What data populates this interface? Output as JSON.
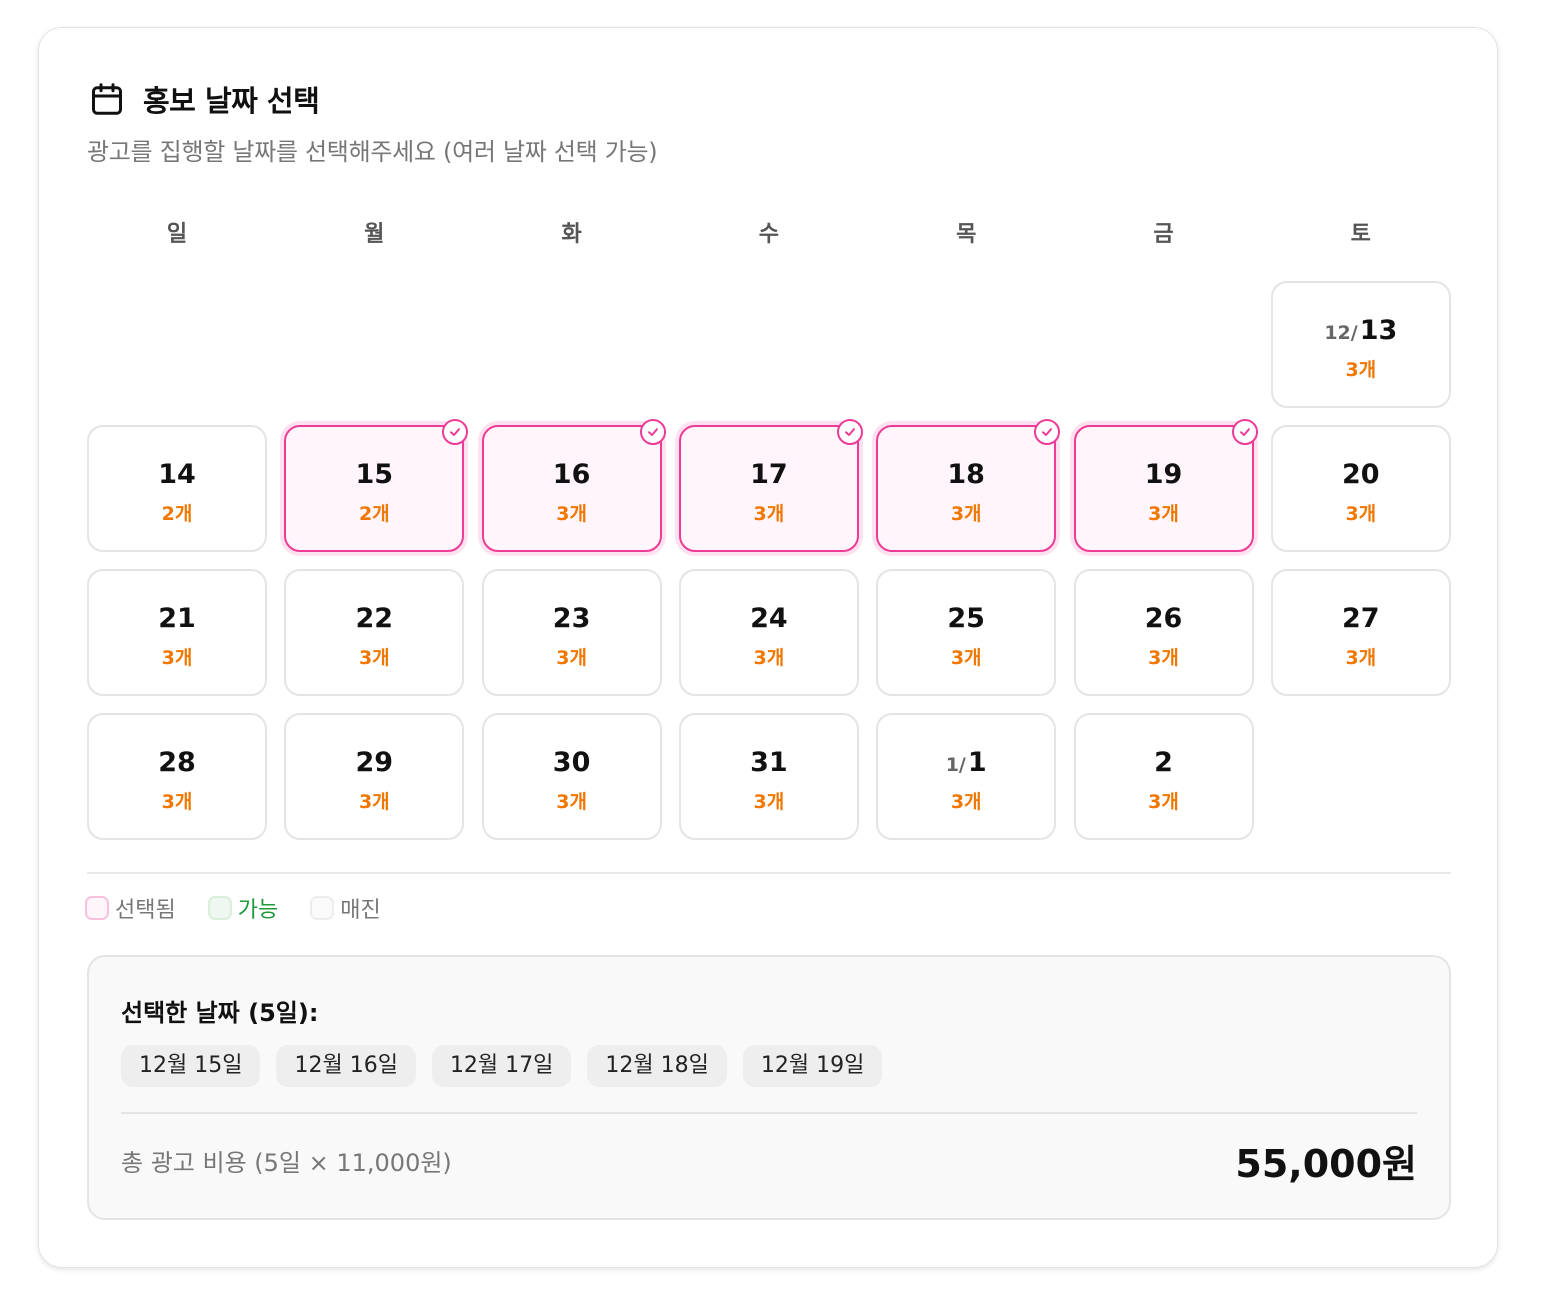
{
  "header": {
    "title": "홍보 날짜 선택",
    "subtitle": "광고를 집행할 날짜를 선택해주세요 (여러 날짜 선택 가능)"
  },
  "weekdays": [
    "일",
    "월",
    "화",
    "수",
    "목",
    "금",
    "토"
  ],
  "calendar": {
    "cells": [
      {
        "month": "12/",
        "day": "13",
        "count": "3개",
        "selected": false,
        "col": 6,
        "row": 0
      },
      {
        "month": "",
        "day": "14",
        "count": "2개",
        "selected": false,
        "col": 0,
        "row": 1
      },
      {
        "month": "",
        "day": "15",
        "count": "2개",
        "selected": true,
        "col": 1,
        "row": 1
      },
      {
        "month": "",
        "day": "16",
        "count": "3개",
        "selected": true,
        "col": 2,
        "row": 1
      },
      {
        "month": "",
        "day": "17",
        "count": "3개",
        "selected": true,
        "col": 3,
        "row": 1
      },
      {
        "month": "",
        "day": "18",
        "count": "3개",
        "selected": true,
        "col": 4,
        "row": 1
      },
      {
        "month": "",
        "day": "19",
        "count": "3개",
        "selected": true,
        "col": 5,
        "row": 1
      },
      {
        "month": "",
        "day": "20",
        "count": "3개",
        "selected": false,
        "col": 6,
        "row": 1
      },
      {
        "month": "",
        "day": "21",
        "count": "3개",
        "selected": false,
        "col": 0,
        "row": 2
      },
      {
        "month": "",
        "day": "22",
        "count": "3개",
        "selected": false,
        "col": 1,
        "row": 2
      },
      {
        "month": "",
        "day": "23",
        "count": "3개",
        "selected": false,
        "col": 2,
        "row": 2
      },
      {
        "month": "",
        "day": "24",
        "count": "3개",
        "selected": false,
        "col": 3,
        "row": 2
      },
      {
        "month": "",
        "day": "25",
        "count": "3개",
        "selected": false,
        "col": 4,
        "row": 2
      },
      {
        "month": "",
        "day": "26",
        "count": "3개",
        "selected": false,
        "col": 5,
        "row": 2
      },
      {
        "month": "",
        "day": "27",
        "count": "3개",
        "selected": false,
        "col": 6,
        "row": 2
      },
      {
        "month": "",
        "day": "28",
        "count": "3개",
        "selected": false,
        "col": 0,
        "row": 3
      },
      {
        "month": "",
        "day": "29",
        "count": "3개",
        "selected": false,
        "col": 1,
        "row": 3
      },
      {
        "month": "",
        "day": "30",
        "count": "3개",
        "selected": false,
        "col": 2,
        "row": 3
      },
      {
        "month": "",
        "day": "31",
        "count": "3개",
        "selected": false,
        "col": 3,
        "row": 3
      },
      {
        "month": "1/",
        "day": "1",
        "count": "3개",
        "selected": false,
        "col": 4,
        "row": 3
      },
      {
        "month": "",
        "day": "2",
        "count": "3개",
        "selected": false,
        "col": 5,
        "row": 3
      }
    ]
  },
  "legend": {
    "selected": "선택됨",
    "available": "가능",
    "soldout": "매진"
  },
  "summary": {
    "title": "선택한 날짜 (5일):",
    "chips": [
      "12월 15일",
      "12월 16일",
      "12월 17일",
      "12월 18일",
      "12월 19일"
    ],
    "total_label": "총 광고 비용 (5일 × 11,000원)",
    "total_value": "55,000원"
  },
  "colors": {
    "accent": "#ec3c97",
    "count": "#f07700",
    "available": "#1e9a3c"
  },
  "icons": {
    "title": "calendar-icon",
    "selected_mark": "check-circle-icon"
  }
}
